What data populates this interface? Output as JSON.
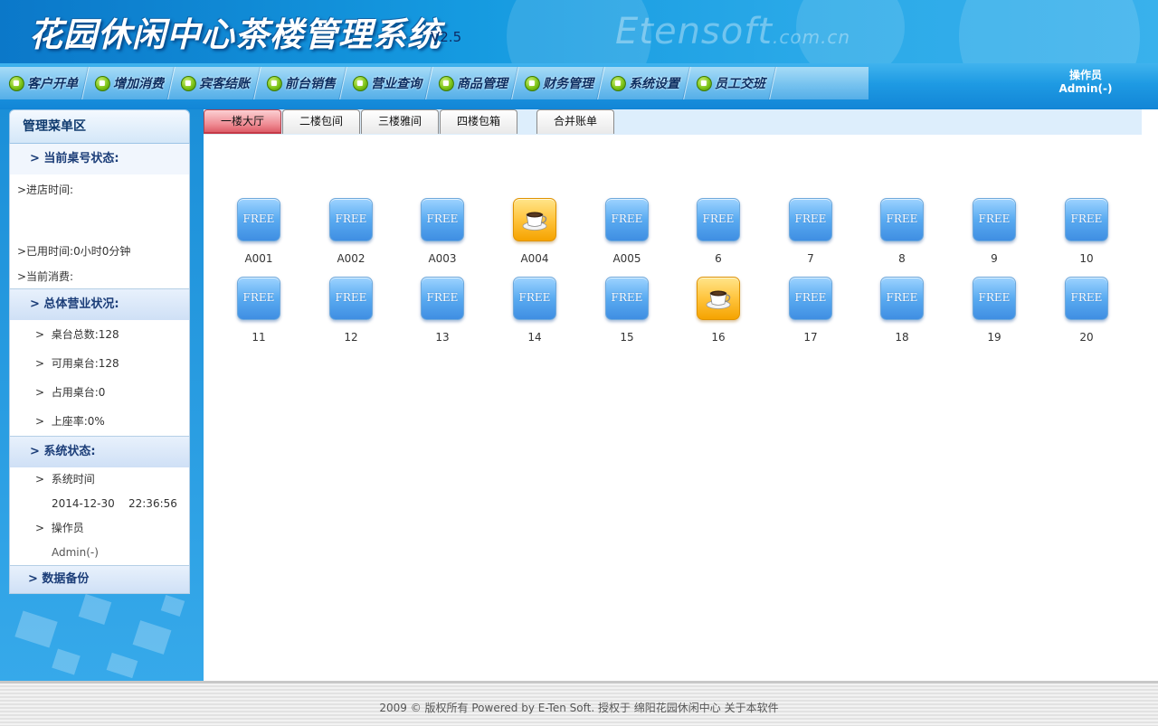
{
  "header": {
    "title": "花园休闲中心茶楼管理系统",
    "version": "V2.5",
    "watermark_main": "Etensoft",
    "watermark_suffix": ".com.cn"
  },
  "nav": {
    "items": [
      {
        "label": "客户开单",
        "icon": "green-dot-icon"
      },
      {
        "label": "增加消费",
        "icon": "green-dot-icon"
      },
      {
        "label": "宾客结账",
        "icon": "green-dot-icon"
      },
      {
        "label": "前台销售",
        "icon": "green-dot-icon"
      },
      {
        "label": "营业查询",
        "icon": "green-dot-icon"
      },
      {
        "label": "商品管理",
        "icon": "green-dot-icon"
      },
      {
        "label": "财务管理",
        "icon": "green-dot-icon"
      },
      {
        "label": "系统设置",
        "icon": "green-dot-icon"
      },
      {
        "label": "员工交班",
        "icon": "green-dot-icon"
      }
    ],
    "operator_label": "操作员",
    "operator_name": "Admin(-)"
  },
  "sidebar": {
    "title": "管理菜单区",
    "current_table": {
      "heading": "> 当前桌号状态:",
      "enter_time": ">进店时间:",
      "used_time": ">已用时间:0小时0分钟",
      "current_spend": ">当前消费:"
    },
    "business": {
      "heading": "> 总体营业状况:",
      "total_tables": "桌台总数:128",
      "available_tables": "可用桌台:128",
      "occupied_tables": "占用桌台:0",
      "seat_rate": "上座率:0%"
    },
    "system": {
      "heading": "> 系统状态:",
      "time_label": "系统时间",
      "time_value": "2014-12-30    22:36:56",
      "operator_label": "操作员",
      "operator_value": "Admin(-)"
    },
    "backup": {
      "heading": "> 数据备份"
    },
    "chevron": ">"
  },
  "tabs": [
    {
      "label": "一楼大厅",
      "active": true
    },
    {
      "label": "二楼包间",
      "active": false
    },
    {
      "label": "三楼雅间",
      "active": false
    },
    {
      "label": "四楼包箱",
      "active": false
    },
    {
      "label": "合并账单",
      "active": false
    }
  ],
  "free_text": "FREE",
  "tables": [
    {
      "label": "A001",
      "busy": false
    },
    {
      "label": "A002",
      "busy": false
    },
    {
      "label": "A003",
      "busy": false
    },
    {
      "label": "A004",
      "busy": true
    },
    {
      "label": "A005",
      "busy": false
    },
    {
      "label": "6",
      "busy": false
    },
    {
      "label": "7",
      "busy": false
    },
    {
      "label": "8",
      "busy": false
    },
    {
      "label": "9",
      "busy": false
    },
    {
      "label": "10",
      "busy": false
    },
    {
      "label": "11",
      "busy": false
    },
    {
      "label": "12",
      "busy": false
    },
    {
      "label": "13",
      "busy": false
    },
    {
      "label": "14",
      "busy": false
    },
    {
      "label": "15",
      "busy": false
    },
    {
      "label": "16",
      "busy": true
    },
    {
      "label": "17",
      "busy": false
    },
    {
      "label": "18",
      "busy": false
    },
    {
      "label": "19",
      "busy": false
    },
    {
      "label": "20",
      "busy": false
    }
  ],
  "footer": {
    "text": "2009 © 版权所有  Powered by E-Ten Soft. 授权于  绵阳花园休闲中心  关于本软件"
  },
  "colors": {
    "header_blue": "#159ae0",
    "free_blue": "#5aabf1",
    "busy_orange": "#ffc43d",
    "active_tab": "#ef8b93"
  }
}
